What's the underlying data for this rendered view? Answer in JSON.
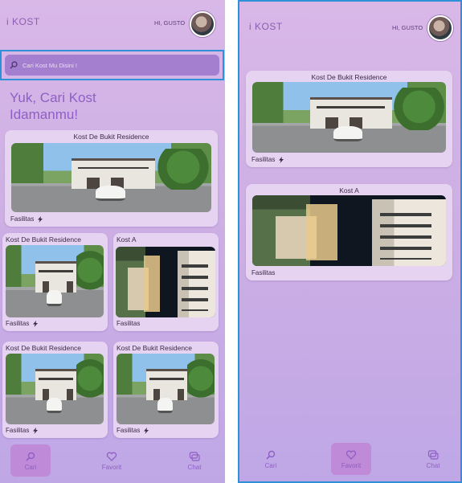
{
  "left": {
    "logo": "i KOST",
    "greeting": "HI, GUSTO",
    "search": {
      "placeholder": "Cari Kost Mu Disini !"
    },
    "headline_line1": "Yuk, Cari Kost",
    "headline_line2": "Idamanmu!",
    "cards": [
      {
        "title": "Kost De Bukit Residence",
        "facilities": "Fasilitas",
        "icon": "lightning-icon"
      },
      {
        "title": "Kost De Bukit Residence",
        "facilities": "Fasilitas",
        "icon": "lightning-icon"
      },
      {
        "title": "Kost A",
        "facilities": "Fasilitas"
      },
      {
        "title": "Kost De Bukit Residence",
        "facilities": "Fasilitas",
        "icon": "lightning-icon"
      },
      {
        "title": "Kost De Bukit Residence",
        "facilities": "Fasilitas",
        "icon": "lightning-icon"
      }
    ],
    "nav": {
      "cari": "Cari",
      "favorit": "Favorit",
      "chat": "Chat",
      "active": "cari"
    }
  },
  "right": {
    "logo": "i KOST",
    "greeting": "HI, GUSTO",
    "cards": [
      {
        "title": "Kost De Bukit Residence",
        "facilities": "Fasilitas",
        "icon": "lightning-icon"
      },
      {
        "title": "Kost A",
        "facilities": "Fasilitas"
      }
    ],
    "nav": {
      "cari": "Cari",
      "favorit": "Favorit",
      "chat": "Chat",
      "active": "favorit"
    }
  },
  "colors": {
    "accent": "#8e5fc4",
    "selection": "#2f8fd8",
    "search_bg": "#a57fcf",
    "card_bg": "#e5d3f1"
  }
}
